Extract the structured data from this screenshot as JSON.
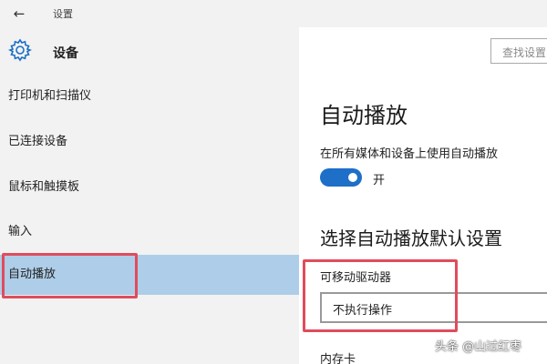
{
  "window": {
    "title": "设置",
    "back_icon": "back-arrow-icon"
  },
  "header": {
    "title": "设备",
    "icon": "gear-icon",
    "search_placeholder": "查找设置"
  },
  "sidebar": {
    "items": [
      {
        "label": "打印机和扫描仪",
        "selected": false
      },
      {
        "label": "已连接设备",
        "selected": false
      },
      {
        "label": "鼠标和触摸板",
        "selected": false
      },
      {
        "label": "输入",
        "selected": false
      },
      {
        "label": "自动播放",
        "selected": true
      }
    ]
  },
  "main": {
    "heading": "自动播放",
    "toggle": {
      "label": "在所有媒体和设备上使用自动播放",
      "state": "开",
      "on": true
    },
    "defaults_heading": "选择自动播放默认设置",
    "removable_drive": {
      "label": "可移动驱动器",
      "value": "不执行操作"
    },
    "memory_card": {
      "label": "内存卡"
    }
  },
  "watermark": "头条 @山过红枣",
  "colors": {
    "accent": "#1d6fc7",
    "selected_bg": "#aecde8",
    "highlight": "#e04c5c"
  }
}
